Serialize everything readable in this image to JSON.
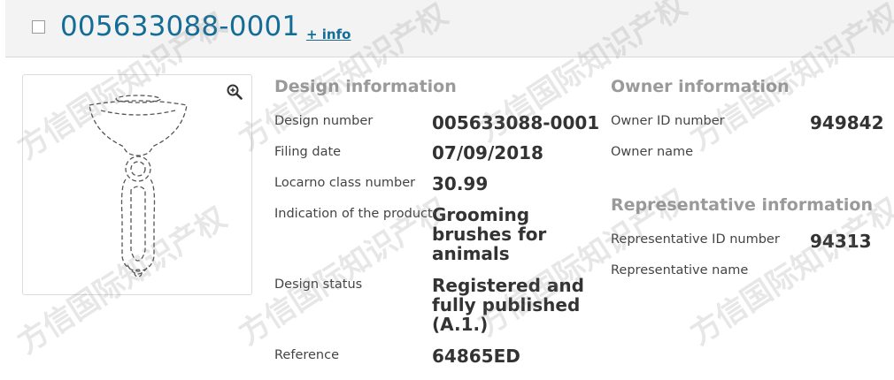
{
  "header": {
    "title": "005633088-0001",
    "info_link": "+ info"
  },
  "image_panel": {
    "zoom_icon": "zoom-in-icon"
  },
  "design_info": {
    "section_title": "Design information",
    "rows": [
      {
        "label": "Design number",
        "value": "005633088-0001"
      },
      {
        "label": "Filing date",
        "value": "07/09/2018"
      },
      {
        "label": "Locarno class number",
        "value": "30.99"
      },
      {
        "label": "Indication of the product",
        "value": "Grooming brushes for animals"
      },
      {
        "label": "Design status",
        "value": "Registered and fully published (A.1.)"
      },
      {
        "label": "Reference",
        "value": "64865ED"
      }
    ]
  },
  "owner_info": {
    "section_title": "Owner information",
    "rows": [
      {
        "label": "Owner ID number",
        "value": "949842"
      },
      {
        "label": "Owner name",
        "value": ""
      }
    ]
  },
  "representative_info": {
    "section_title": "Representative information",
    "rows": [
      {
        "label": "Representative ID number",
        "value": "94313"
      },
      {
        "label": "Representative name",
        "value": ""
      }
    ]
  },
  "watermark": {
    "text": "方信国际知识产权"
  },
  "colors": {
    "title_blue": "#136d96",
    "section_gray": "#9a9a9a",
    "header_bg": "#f3f3f3"
  }
}
